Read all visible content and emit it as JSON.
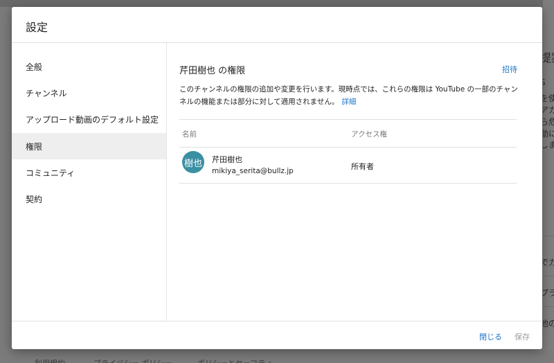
{
  "dialog": {
    "title": "設定",
    "nav": [
      {
        "label": "全般",
        "active": false
      },
      {
        "label": "チャンネル",
        "active": false
      },
      {
        "label": "アップロード動画のデフォルト設定",
        "active": false
      },
      {
        "label": "権限",
        "active": true
      },
      {
        "label": "コミュニティ",
        "active": false
      },
      {
        "label": "契約",
        "active": false
      }
    ],
    "permissions": {
      "title": "芹田樹也 の権限",
      "invite_label": "招待",
      "description": "このチャンネルの権限の追加や変更を行います。現時点では、これらの権限は YouTube の一部のチャンネルの機能または部分に対して適用されません。",
      "detail_link": "詳細",
      "columns": {
        "name": "名前",
        "access": "アクセス権"
      },
      "rows": [
        {
          "avatar_text": "樹也",
          "name": "芹田樹也",
          "email": "mikiya_serita@bullz.jp",
          "role": "所有者"
        }
      ]
    },
    "footer": {
      "close_label": "閉じる",
      "save_label": "保存"
    }
  },
  "background": {
    "right_fragments": [
      "提案",
      "S",
      "を使",
      "アカ",
      "ら危",
      "動に",
      "しま",
      "でカ",
      "プラ",
      "他の"
    ],
    "bottom_fragments": [
      "利用規約",
      "プライバシー ポリシー",
      "ポリシーとセーフティ"
    ]
  },
  "colors": {
    "accent": "#1a73c7",
    "avatar": "#3b8fa3",
    "active_nav": "#eeeeee"
  }
}
